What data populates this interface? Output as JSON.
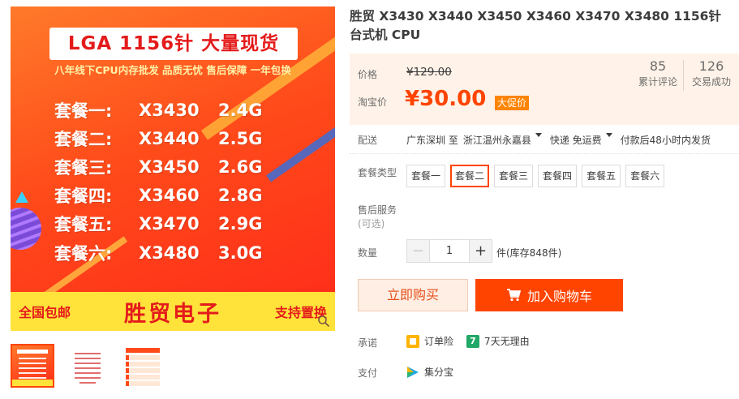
{
  "gallery": {
    "banner_title": "LGA 1156针 大量现货",
    "subline": "八年线下CPU内存批发 品质无忧 售后保障 一年包换",
    "packages": [
      {
        "name": "套餐一:",
        "model": "X3430",
        "freq": "2.4G"
      },
      {
        "name": "套餐二:",
        "model": "X3440",
        "freq": "2.5G"
      },
      {
        "name": "套餐三:",
        "model": "X3450",
        "freq": "2.6G"
      },
      {
        "name": "套餐四:",
        "model": "X3460",
        "freq": "2.8G"
      },
      {
        "name": "套餐五:",
        "model": "X3470",
        "freq": "2.9G"
      },
      {
        "name": "套餐六:",
        "model": "X3480",
        "freq": "3.0G"
      }
    ],
    "footer_left": "全国包邮",
    "footer_brand": "胜贸电子",
    "footer_right": "支持置换",
    "zoom_icon": "zoom-icon",
    "thumbnails_count": 3,
    "active_thumbnail": 1
  },
  "product": {
    "title": "胜贸 X3430 X3440 X3450 X3460 X3470 X3480 1156针 台式机 CPU"
  },
  "price": {
    "price_label": "价格",
    "original_price": "¥129.00",
    "taobao_label": "淘宝价",
    "promo_price": "¥30.00",
    "promo_tag": "大促价",
    "reviews_count": "85",
    "reviews_label": "累计评论",
    "deals_count": "126",
    "deals_label": "交易成功"
  },
  "shipping": {
    "label": "配送",
    "from": "广东深圳 至",
    "to": "浙江温州永嘉县",
    "method": "快递 免运费",
    "note": "付款后48小时内发货"
  },
  "sku": {
    "label": "套餐类型",
    "options": [
      "套餐一",
      "套餐二",
      "套餐三",
      "套餐四",
      "套餐五",
      "套餐六"
    ],
    "selected_index": 1
  },
  "service": {
    "label": "售后服务",
    "sub": "(可选)"
  },
  "quantity": {
    "label": "数量",
    "minus": "−",
    "value": "1",
    "plus": "+",
    "stock": "件(库存848件)"
  },
  "actions": {
    "buy_now": "立即购买",
    "add_to_cart": "加入购物车"
  },
  "promise": {
    "label": "承诺",
    "items": [
      {
        "icon": "insurance-icon",
        "text": "订单险"
      },
      {
        "icon": "seven-day-return-icon",
        "badge": "7",
        "text": "7天无理由"
      }
    ]
  },
  "payment": {
    "label": "支付",
    "icon": "jifenbao-icon",
    "text": "集分宝"
  },
  "colors": {
    "accent": "#ff4400",
    "price_panel_bg": "#fff2e8",
    "promo_tag_bg": "#ff8400"
  }
}
